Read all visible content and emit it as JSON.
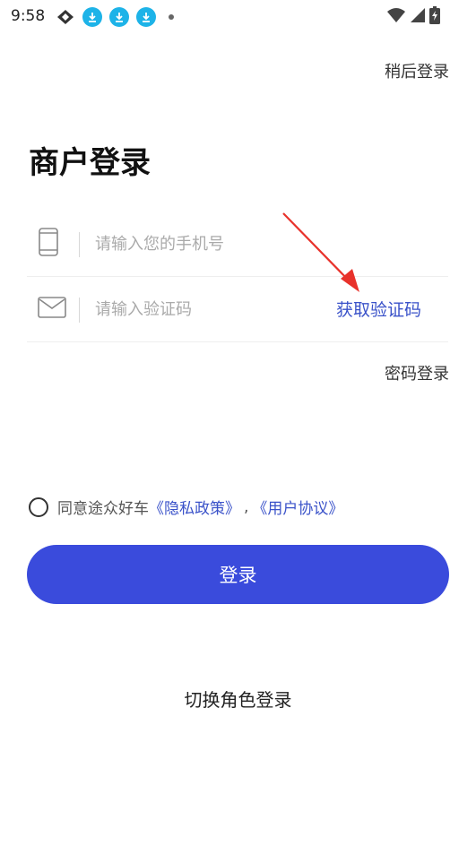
{
  "status_bar": {
    "time": "9:58"
  },
  "header": {
    "later_label": "稍后登录"
  },
  "page": {
    "title": "商户登录"
  },
  "form": {
    "phone_placeholder": "请输入您的手机号",
    "code_placeholder": "请输入验证码",
    "get_code_label": "获取验证码",
    "password_login_label": "密码登录"
  },
  "agreement": {
    "prefix": "同意途众好车",
    "privacy_link": "《隐私政策》",
    "separator": ",",
    "user_link": "《用户协议》"
  },
  "actions": {
    "login_label": "登录",
    "switch_role_label": "切换角色登录"
  },
  "colors": {
    "primary": "#3a4bdc",
    "link": "#3a52c9",
    "annotation": "#e8322b"
  },
  "icons": {
    "phone": "phone-icon",
    "mail": "mail-icon",
    "wifi": "wifi-icon",
    "signal": "signal-icon",
    "battery": "battery-icon",
    "download": "download-icon"
  }
}
